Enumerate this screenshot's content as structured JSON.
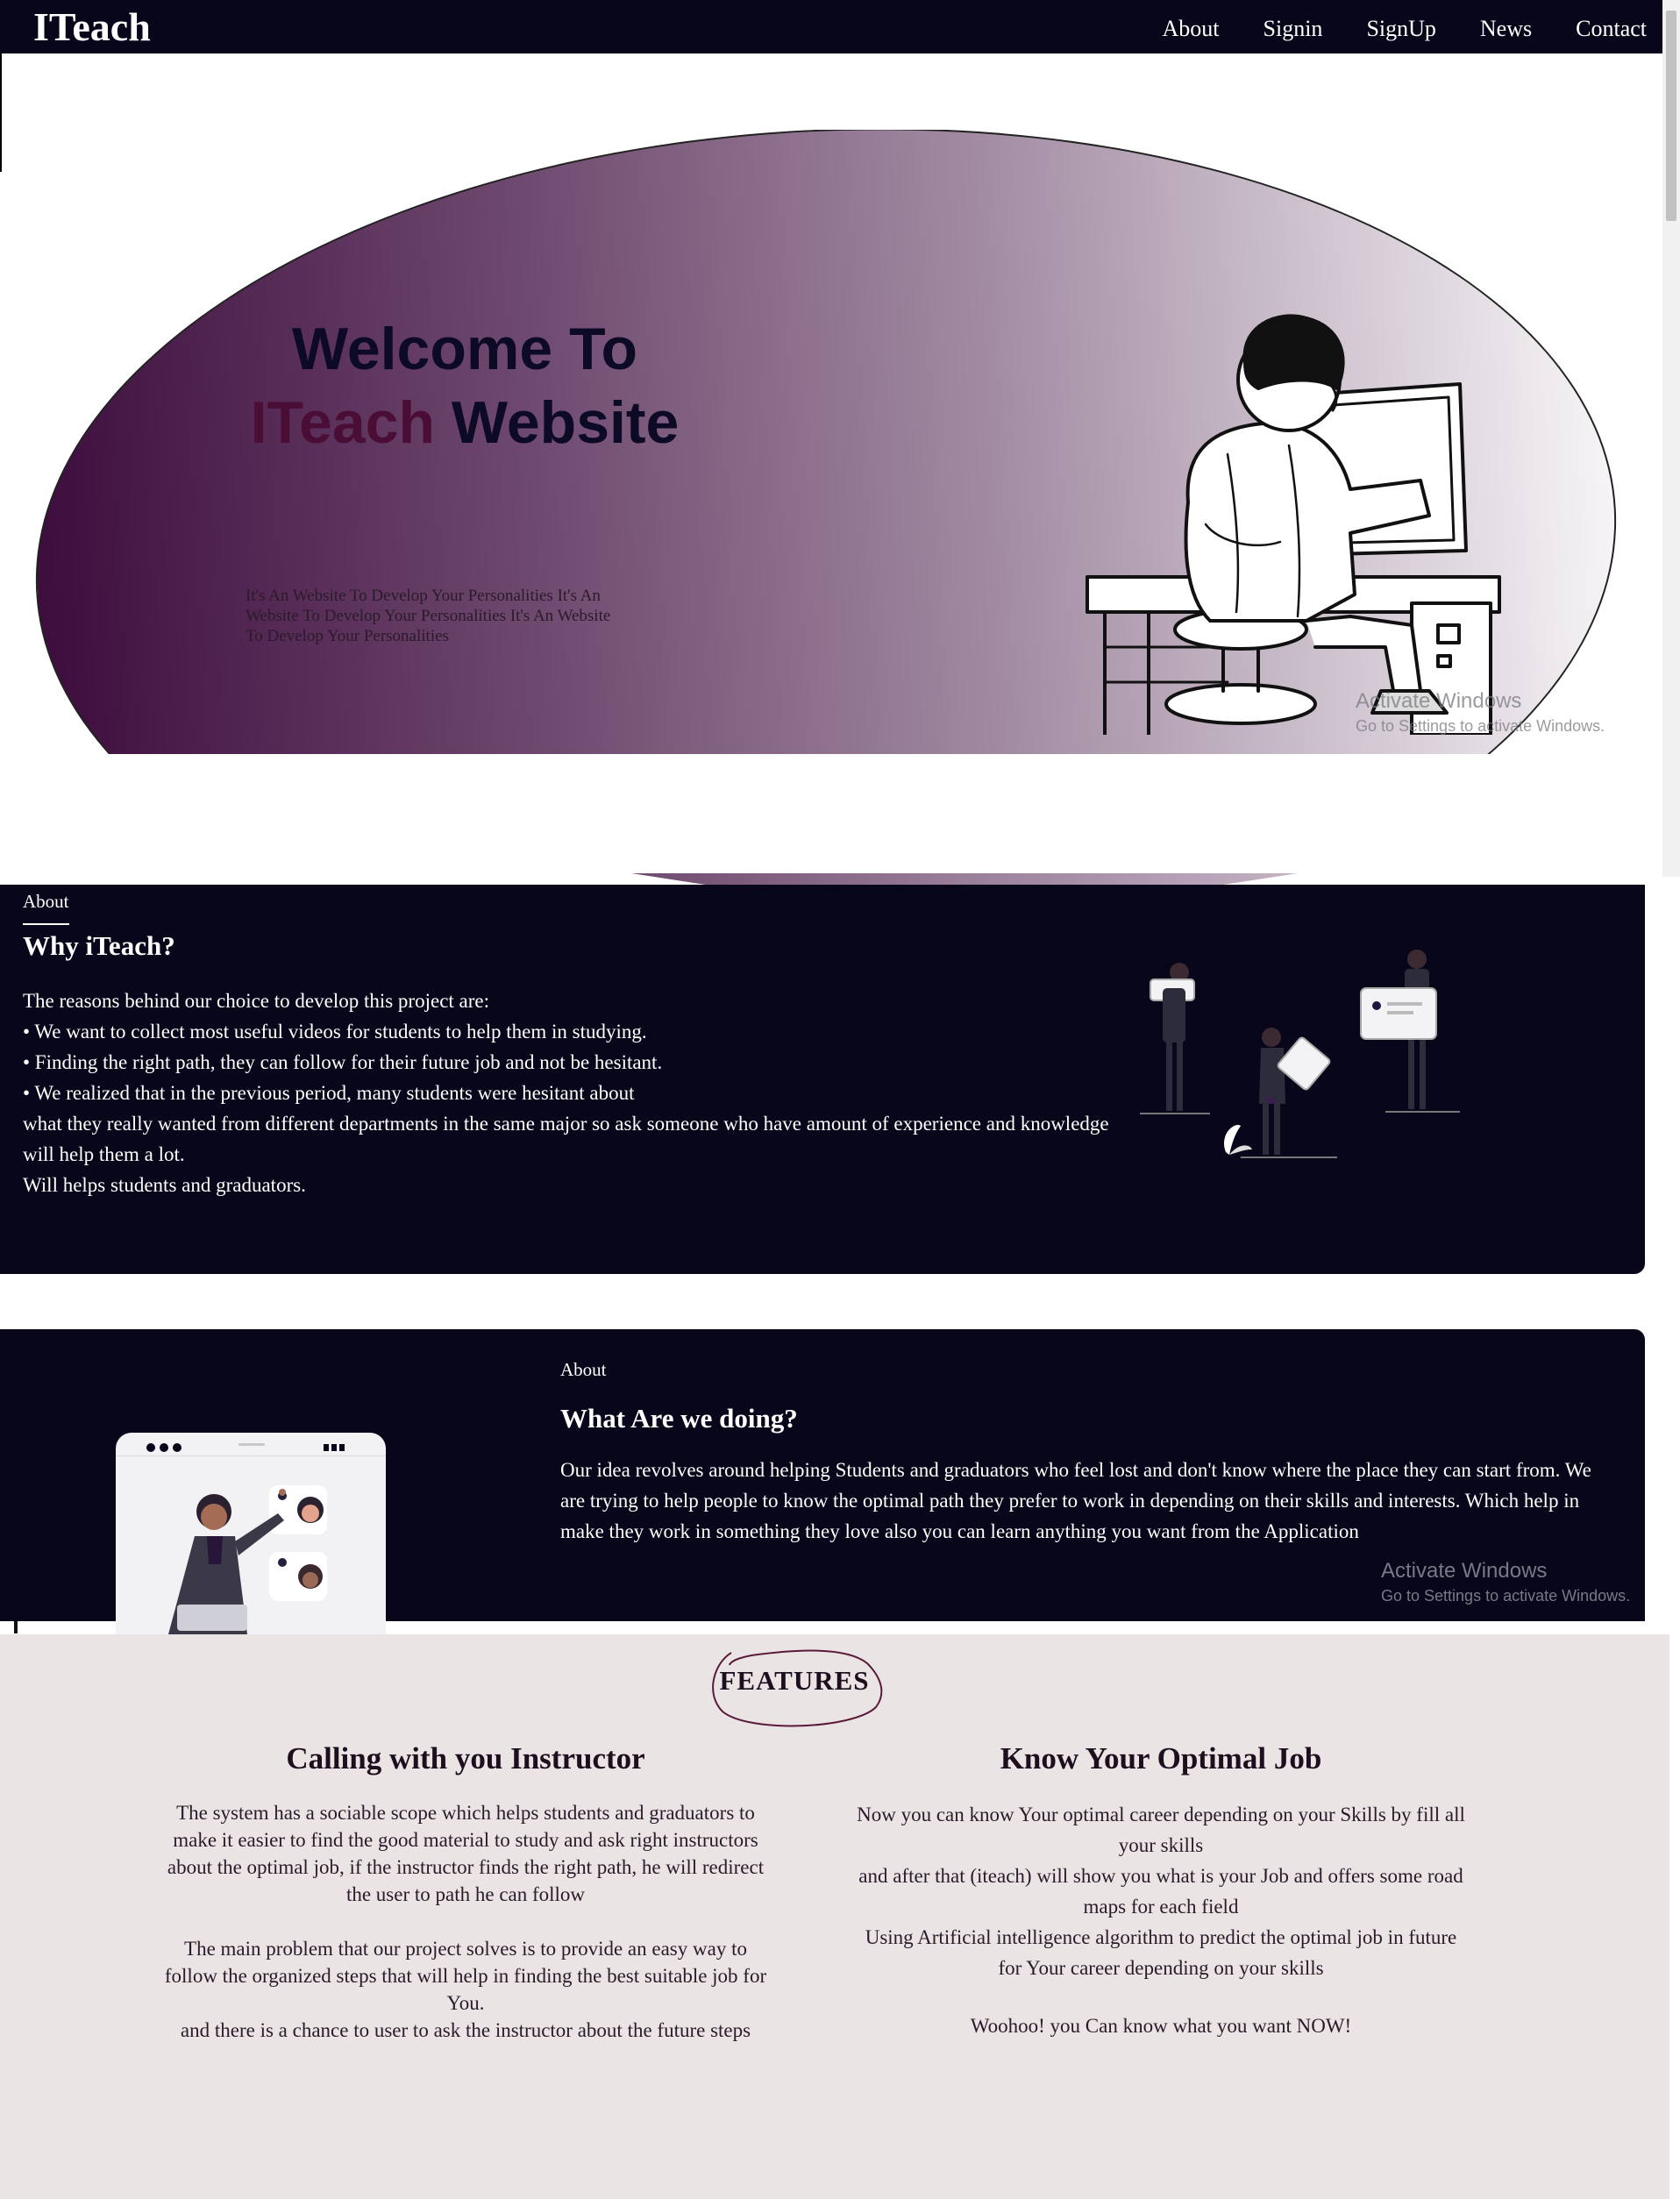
{
  "nav": {
    "brand": "ITeach",
    "links": [
      "About",
      "Signin",
      "SignUp",
      "News",
      "Contact"
    ]
  },
  "hero": {
    "title_line1": "Welcome To",
    "title_accent": "ITeach",
    "title_rest": " Website",
    "subtitle": "It's An Website To Develop Your Personalities It's An Website To Develop Your Personalities It's An Website To Develop Your Personalities"
  },
  "watermark": {
    "title": "Activate Windows",
    "subtitle": "Go to Settings to activate Windows."
  },
  "why": {
    "eyebrow": "About",
    "heading": "Why iTeach?",
    "lines": [
      "The reasons behind our choice to develop this project are:",
      "• We want to collect most useful videos for students to help them in studying.",
      "• Finding the right path, they can follow for their future job and not be hesitant.",
      "• We realized that in the previous period, many students were hesitant about",
      "what they really wanted from different departments in the same major so ask someone who have amount of experience and knowledge will help them a lot.",
      "Will helps students and graduators."
    ]
  },
  "what": {
    "eyebrow": "About",
    "heading": "What Are we doing?",
    "body": "Our idea revolves around helping Students and graduators who feel lost and don't know where the place they can start from. We are trying to help people to know the optimal path they prefer to work in depending on their skills and interests. Which help in make they work in something they love also you can learn anything you want from the Application"
  },
  "features": {
    "title": "FEATURES",
    "col1": {
      "heading": "Calling with you Instructor",
      "para1": "The system has a sociable scope which helps students and graduators to make it easier to find the good material to study and ask right instructors about the optimal job, if the instructor finds the right path, he will redirect the user to path he can follow",
      "para2": "The main problem that our project solves is to provide an easy way to follow the organized steps that will help in finding the best suitable job for You.",
      "para3": "and there is a chance to user to ask the instructor about the future steps"
    },
    "col2": {
      "heading": "Know Your Optimal Job",
      "line1": "Now you can know Your optimal career depending on your Skills by fill all your skills",
      "line2": "and after that (iteach) will show you what is your Job and offers some road maps for each field",
      "line3": "Using Artificial intelligence algorithm to predict the optimal job in future for Your career depending on your skills",
      "line4": "Woohoo! you Can know what you want NOW!"
    }
  },
  "colors": {
    "navy": "#07061a",
    "plum": "#4a0e36",
    "features_bg": "#ebe4e4"
  }
}
